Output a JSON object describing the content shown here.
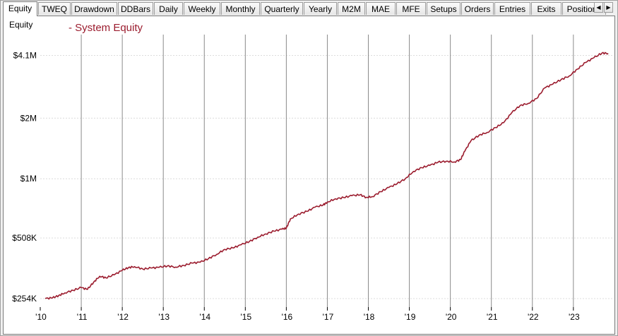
{
  "tabs": [
    "Equity",
    "TWEQ",
    "Drawdown",
    "DDBars",
    "Daily",
    "Weekly",
    "Monthly",
    "Quarterly",
    "Yearly",
    "M2M",
    "MAE",
    "MFE",
    "Setups",
    "Orders",
    "Entries",
    "Exits",
    "Positions"
  ],
  "active_tab": "Equity",
  "scroll": {
    "left": "◀",
    "right": "▶"
  },
  "pane_title": "Equity",
  "legend_text": "- System Equity",
  "colors": {
    "series": "#9b1c2e",
    "legend": "#9b1c2e",
    "vgrid": "#8a8a8a",
    "hgrid": "#dcdcdc"
  },
  "chart_data": {
    "type": "line",
    "title": "",
    "xlabel": "",
    "ylabel": "Equity",
    "y_scale": "log",
    "yticks": [
      {
        "value": 254000,
        "label": "$254K"
      },
      {
        "value": 508000,
        "label": "$508K"
      },
      {
        "value": 1000000,
        "label": "$1M"
      },
      {
        "value": 2000000,
        "label": "$2M"
      },
      {
        "value": 4100000,
        "label": "$4.1M"
      }
    ],
    "xticks": [
      "'10",
      "'11",
      "'12",
      "'13",
      "'14",
      "'15",
      "'16",
      "'17",
      "'18",
      "'19",
      "'20",
      "'21",
      "'22",
      "'23"
    ],
    "xlim": [
      2010.0,
      2023.95
    ],
    "ylim": [
      238000,
      5200000
    ],
    "grid": {
      "vertical": true,
      "horizontal": true
    },
    "legend_placement": "top-left",
    "series": [
      {
        "name": "System Equity",
        "points": [
          [
            2010.12,
            254000
          ],
          [
            2010.3,
            256000
          ],
          [
            2010.45,
            263000
          ],
          [
            2010.6,
            271000
          ],
          [
            2010.8,
            279000
          ],
          [
            2011.0,
            288000
          ],
          [
            2011.15,
            282000
          ],
          [
            2011.3,
            306000
          ],
          [
            2011.45,
            328000
          ],
          [
            2011.6,
            322000
          ],
          [
            2011.8,
            333000
          ],
          [
            2012.0,
            351000
          ],
          [
            2012.15,
            362000
          ],
          [
            2012.3,
            366000
          ],
          [
            2012.5,
            356000
          ],
          [
            2012.7,
            360000
          ],
          [
            2012.9,
            363000
          ],
          [
            2013.1,
            369000
          ],
          [
            2013.3,
            364000
          ],
          [
            2013.5,
            371000
          ],
          [
            2013.7,
            381000
          ],
          [
            2013.9,
            385000
          ],
          [
            2014.1,
            401000
          ],
          [
            2014.3,
            421000
          ],
          [
            2014.5,
            446000
          ],
          [
            2014.7,
            453000
          ],
          [
            2014.9,
            470000
          ],
          [
            2015.1,
            488000
          ],
          [
            2015.3,
            512000
          ],
          [
            2015.5,
            532000
          ],
          [
            2015.7,
            549000
          ],
          [
            2015.9,
            562000
          ],
          [
            2016.0,
            568000
          ],
          [
            2016.1,
            632000
          ],
          [
            2016.3,
            668000
          ],
          [
            2016.5,
            688000
          ],
          [
            2016.7,
            722000
          ],
          [
            2016.9,
            741000
          ],
          [
            2017.0,
            765000
          ],
          [
            2017.2,
            795000
          ],
          [
            2017.4,
            806000
          ],
          [
            2017.6,
            824000
          ],
          [
            2017.8,
            832000
          ],
          [
            2017.95,
            808000
          ],
          [
            2018.1,
            815000
          ],
          [
            2018.3,
            862000
          ],
          [
            2018.5,
            905000
          ],
          [
            2018.7,
            944000
          ],
          [
            2018.9,
            1000000
          ],
          [
            2019.1,
            1088000
          ],
          [
            2019.3,
            1135000
          ],
          [
            2019.5,
            1165000
          ],
          [
            2019.7,
            1208000
          ],
          [
            2019.9,
            1222000
          ],
          [
            2020.1,
            1212000
          ],
          [
            2020.25,
            1245000
          ],
          [
            2020.35,
            1368000
          ],
          [
            2020.5,
            1542000
          ],
          [
            2020.7,
            1646000
          ],
          [
            2020.9,
            1700000
          ],
          [
            2021.1,
            1795000
          ],
          [
            2021.3,
            1898000
          ],
          [
            2021.5,
            2130000
          ],
          [
            2021.7,
            2312000
          ],
          [
            2021.9,
            2368000
          ],
          [
            2022.1,
            2502000
          ],
          [
            2022.3,
            2824000
          ],
          [
            2022.5,
            2952000
          ],
          [
            2022.7,
            3108000
          ],
          [
            2022.9,
            3240000
          ],
          [
            2023.1,
            3508000
          ],
          [
            2023.3,
            3780000
          ],
          [
            2023.5,
            3990000
          ],
          [
            2023.7,
            4215000
          ],
          [
            2023.85,
            4190000
          ]
        ]
      }
    ]
  }
}
